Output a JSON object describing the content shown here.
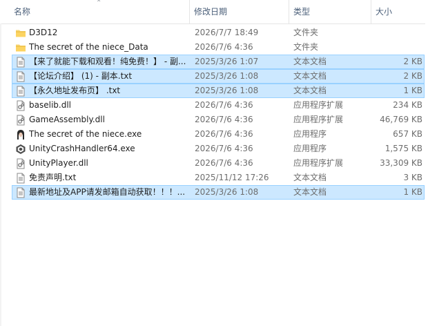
{
  "columns": {
    "name": "名称",
    "date": "修改日期",
    "type": "类型",
    "size": "大小"
  },
  "files": [
    {
      "name": "D3D12",
      "date": "2026/7/7 18:49",
      "type": "文件夹",
      "size": "",
      "icon": "folder",
      "selected": false
    },
    {
      "name": "The secret of the niece_Data",
      "date": "2026/7/6 4:36",
      "type": "文件夹",
      "size": "",
      "icon": "folder",
      "selected": false
    },
    {
      "name": "【来了就能下载和观看！纯免费！】 - 副...",
      "date": "2025/3/26 1:07",
      "type": "文本文档",
      "size": "2 KB",
      "icon": "text-file",
      "selected": true
    },
    {
      "name": "【论坛介绍】 (1) - 副本.txt",
      "date": "2025/3/26 1:08",
      "type": "文本文档",
      "size": "2 KB",
      "icon": "text-file",
      "selected": true
    },
    {
      "name": "【永久地址发布页】 .txt",
      "date": "2025/3/26 1:08",
      "type": "文本文档",
      "size": "1 KB",
      "icon": "text-file",
      "selected": true
    },
    {
      "name": "baselib.dll",
      "date": "2026/7/6 4:36",
      "type": "应用程序扩展",
      "size": "234 KB",
      "icon": "dll-file",
      "selected": false
    },
    {
      "name": "GameAssembly.dll",
      "date": "2026/7/6 4:36",
      "type": "应用程序扩展",
      "size": "46,769 KB",
      "icon": "dll-file",
      "selected": false
    },
    {
      "name": "The secret of the niece.exe",
      "date": "2026/7/6 4:36",
      "type": "应用程序",
      "size": "657 KB",
      "icon": "game-exe",
      "selected": false
    },
    {
      "name": "UnityCrashHandler64.exe",
      "date": "2026/7/6 4:36",
      "type": "应用程序",
      "size": "1,575 KB",
      "icon": "unity-exe",
      "selected": false
    },
    {
      "name": "UnityPlayer.dll",
      "date": "2026/7/6 4:36",
      "type": "应用程序扩展",
      "size": "33,309 KB",
      "icon": "dll-file",
      "selected": false
    },
    {
      "name": "免责声明.txt",
      "date": "2025/11/12 17:26",
      "type": "文本文档",
      "size": "3 KB",
      "icon": "text-file",
      "selected": false
    },
    {
      "name": "最新地址及APP请发邮箱自动获取！！！...",
      "date": "2025/3/26 1:08",
      "type": "文本文档",
      "size": "1 KB",
      "icon": "text-file",
      "selected": true
    }
  ]
}
